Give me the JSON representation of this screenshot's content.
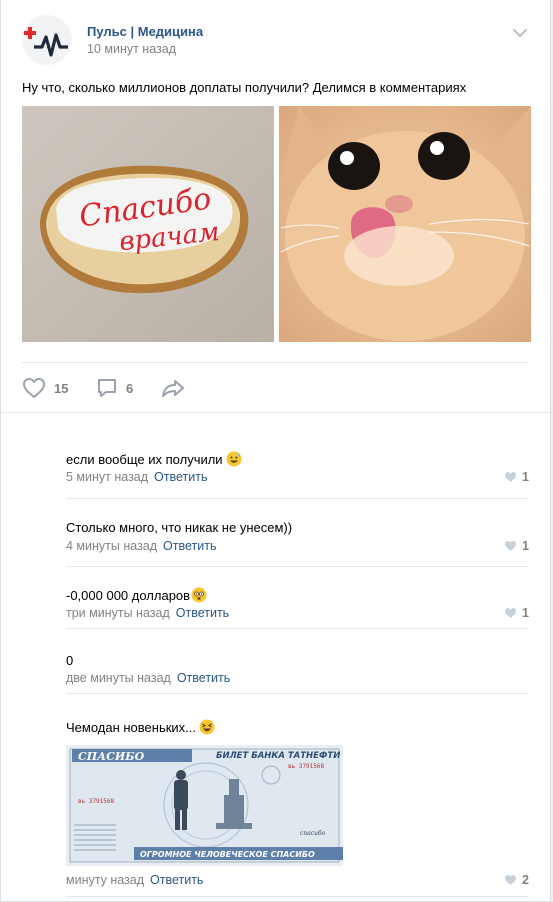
{
  "post": {
    "author": "Пульс | Медицина",
    "time": "10 минут назад",
    "text": "Ну что, сколько миллионов доплаты получили? Делимся в комментариях",
    "photo1_caption": [
      "Спасибо",
      "врачам"
    ],
    "likes": "15",
    "comments": "6"
  },
  "comments": [
    {
      "text": "если вообще их получили",
      "emoji": "sweat-smile",
      "time": "5 минут назад",
      "reply": "Ответить",
      "likes": "1"
    },
    {
      "text": "Столько много, что никак не унесем))",
      "emoji": "",
      "time": "4 минуты назад",
      "reply": "Ответить",
      "likes": "1"
    },
    {
      "text": "-0,000 000 долларов",
      "emoji": "dizzy",
      "time": "три минуты назад",
      "reply": "Ответить",
      "likes": "1"
    },
    {
      "text": "0",
      "emoji": "",
      "time": "две минуты назад",
      "reply": "Ответить",
      "likes": ""
    },
    {
      "text": "Чемодан новеньких...",
      "emoji": "laughing",
      "time": "минуту назад",
      "reply": "Ответить",
      "likes": "2"
    }
  ],
  "banknote": {
    "left_title": "СПАСИБО",
    "right_title": "БИЛЕТ БАНКА ТАТНЕФТИ",
    "serial_top": "вь 3791568",
    "serial_left": "вь 3791568",
    "bottom_text": "ОГРОМНОЕ ЧЕЛОВЕЧЕСКОЕ СПАСИБО",
    "signature": "спасибо"
  },
  "colors": {
    "link": "#2a5885",
    "meta": "#828282",
    "icon": "#99a2ad",
    "accent_red": "#e64646"
  }
}
